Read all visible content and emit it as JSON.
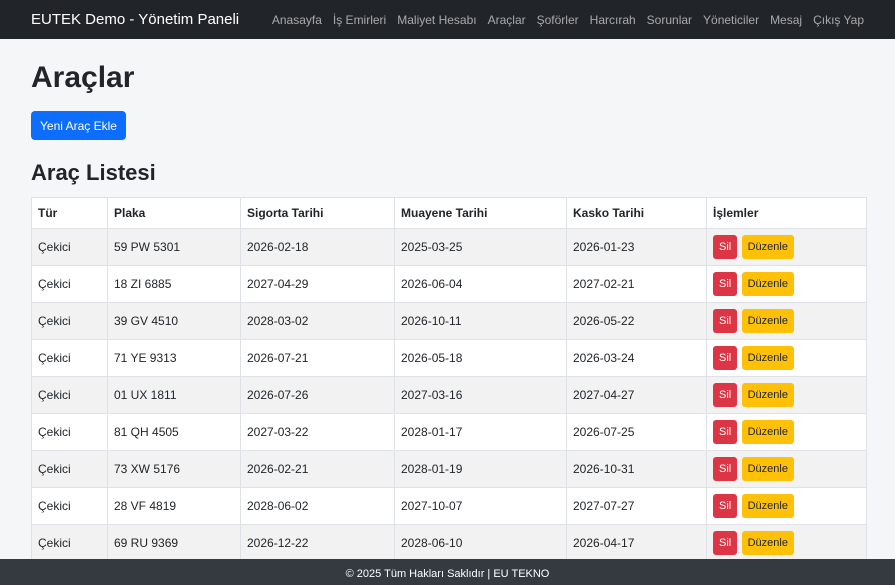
{
  "brand": "EUTEK Demo - Yönetim Paneli",
  "nav": [
    "Anasayfa",
    "İş Emirleri",
    "Maliyet Hesabı",
    "Araçlar",
    "Şoförler",
    "Harcırah",
    "Sorunlar",
    "Yöneticiler",
    "Mesaj",
    "Çıkış Yap"
  ],
  "page_title": "Araçlar",
  "add_button": "Yeni Araç Ekle",
  "list_title": "Araç Listesi",
  "columns": [
    "Tür",
    "Plaka",
    "Sigorta Tarihi",
    "Muayene Tarihi",
    "Kasko Tarihi",
    "İşlemler"
  ],
  "rows": [
    [
      "Çekici",
      "59 PW 5301",
      "2026-02-18",
      "2025-03-25",
      "2026-01-23"
    ],
    [
      "Çekici",
      "18 ZI 6885",
      "2027-04-29",
      "2026-06-04",
      "2027-02-21"
    ],
    [
      "Çekici",
      "39 GV 4510",
      "2028-03-02",
      "2026-10-11",
      "2026-05-22"
    ],
    [
      "Çekici",
      "71 YE 9313",
      "2026-07-21",
      "2026-05-18",
      "2026-03-24"
    ],
    [
      "Çekici",
      "01 UX 1811",
      "2026-07-26",
      "2027-03-16",
      "2027-04-27"
    ],
    [
      "Çekici",
      "81 QH 4505",
      "2027-03-22",
      "2028-01-17",
      "2026-07-25"
    ],
    [
      "Çekici",
      "73 XW 5176",
      "2026-02-21",
      "2028-01-19",
      "2026-10-31"
    ],
    [
      "Çekici",
      "28 VF 4819",
      "2028-06-02",
      "2027-10-07",
      "2027-07-27"
    ],
    [
      "Çekici",
      "69 RU 9369",
      "2026-12-22",
      "2028-06-10",
      "2026-04-17"
    ]
  ],
  "actions": {
    "delete": "Sil",
    "edit": "Düzenle"
  },
  "footer": "© 2025 Tüm Hakları Saklıdır | EU TEKNO"
}
